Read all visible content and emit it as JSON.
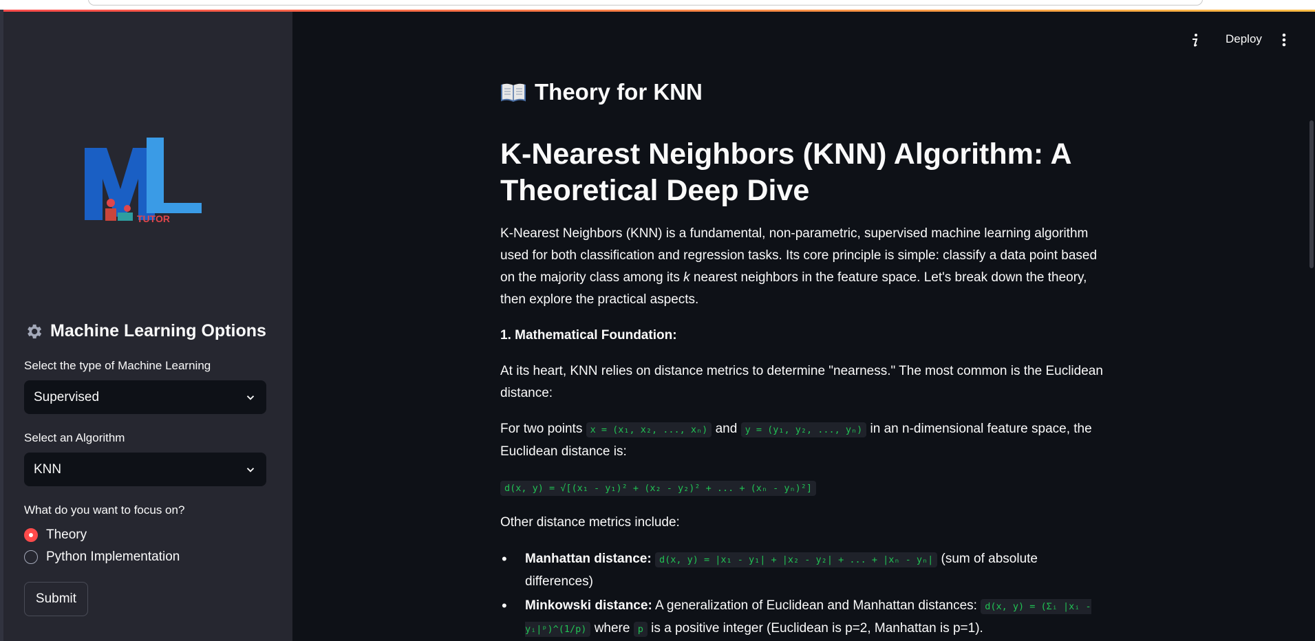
{
  "sidebar": {
    "logo": {
      "text_main": "ML",
      "text_sub": "TUTOR"
    },
    "header": "Machine Learning Options",
    "ml_type": {
      "label": "Select the type of Machine Learning",
      "value": "Supervised"
    },
    "algorithm": {
      "label": "Select an Algorithm",
      "value": "KNN"
    },
    "focus": {
      "label": "What do you want to focus on?",
      "options": [
        "Theory",
        "Python Implementation"
      ],
      "selected": "Theory"
    },
    "submit_label": "Submit"
  },
  "toolbar": {
    "deploy_label": "Deploy"
  },
  "main": {
    "section_title": "Theory for KNN",
    "heading": "K-Nearest Neighbors (KNN) Algorithm: A Theoretical Deep Dive",
    "intro_1": "K-Nearest Neighbors (KNN) is a fundamental, non-parametric, supervised machine learning algorithm used for both classification and regression tasks. Its core principle is simple: classify a data point based on the majority class among its ",
    "intro_k": "k",
    "intro_2": " nearest neighbors in the feature space. Let's break down the theory, then explore the practical aspects.",
    "math_heading": "1. Mathematical Foundation:",
    "distance_intro": "At its heart, KNN relies on distance metrics to determine \"nearness.\" The most common is the Euclidean distance:",
    "two_points_a": "For two points",
    "code_x": "x = (x₁, x₂, ..., xₙ)",
    "two_points_and": "and",
    "code_y": "y = (y₁, y₂, ..., yₙ)",
    "two_points_b": "in an n-dimensional feature space, the Euclidean distance is:",
    "euclid_code": "d(x, y) = √[(x₁ - y₁)² + (x₂ - y₂)² + ... + (xₙ - yₙ)²]",
    "other_metrics": "Other distance metrics include:",
    "manhattan": {
      "name": "Manhattan distance:",
      "code": "d(x, y) = |x₁ - y₁| + |x₂ - y₂| + ... + |xₙ - yₙ|",
      "suffix": "(sum of absolute differences)"
    },
    "minkowski": {
      "name": "Minkowski distance:",
      "prefix": "A generalization of Euclidean and Manhattan distances:",
      "code": "d(x, y) = (Σᵢ |xᵢ - yᵢ|ᵖ)^(1/p)",
      "where": "where",
      "code_p": "p",
      "suffix": "is a positive integer (Euclidean is p=2, Manhattan is p=1)."
    }
  },
  "colors": {
    "accent": "#ff4b4b",
    "code_green": "#21c354",
    "sidebar_bg": "#262730",
    "main_bg": "#0e1117"
  }
}
